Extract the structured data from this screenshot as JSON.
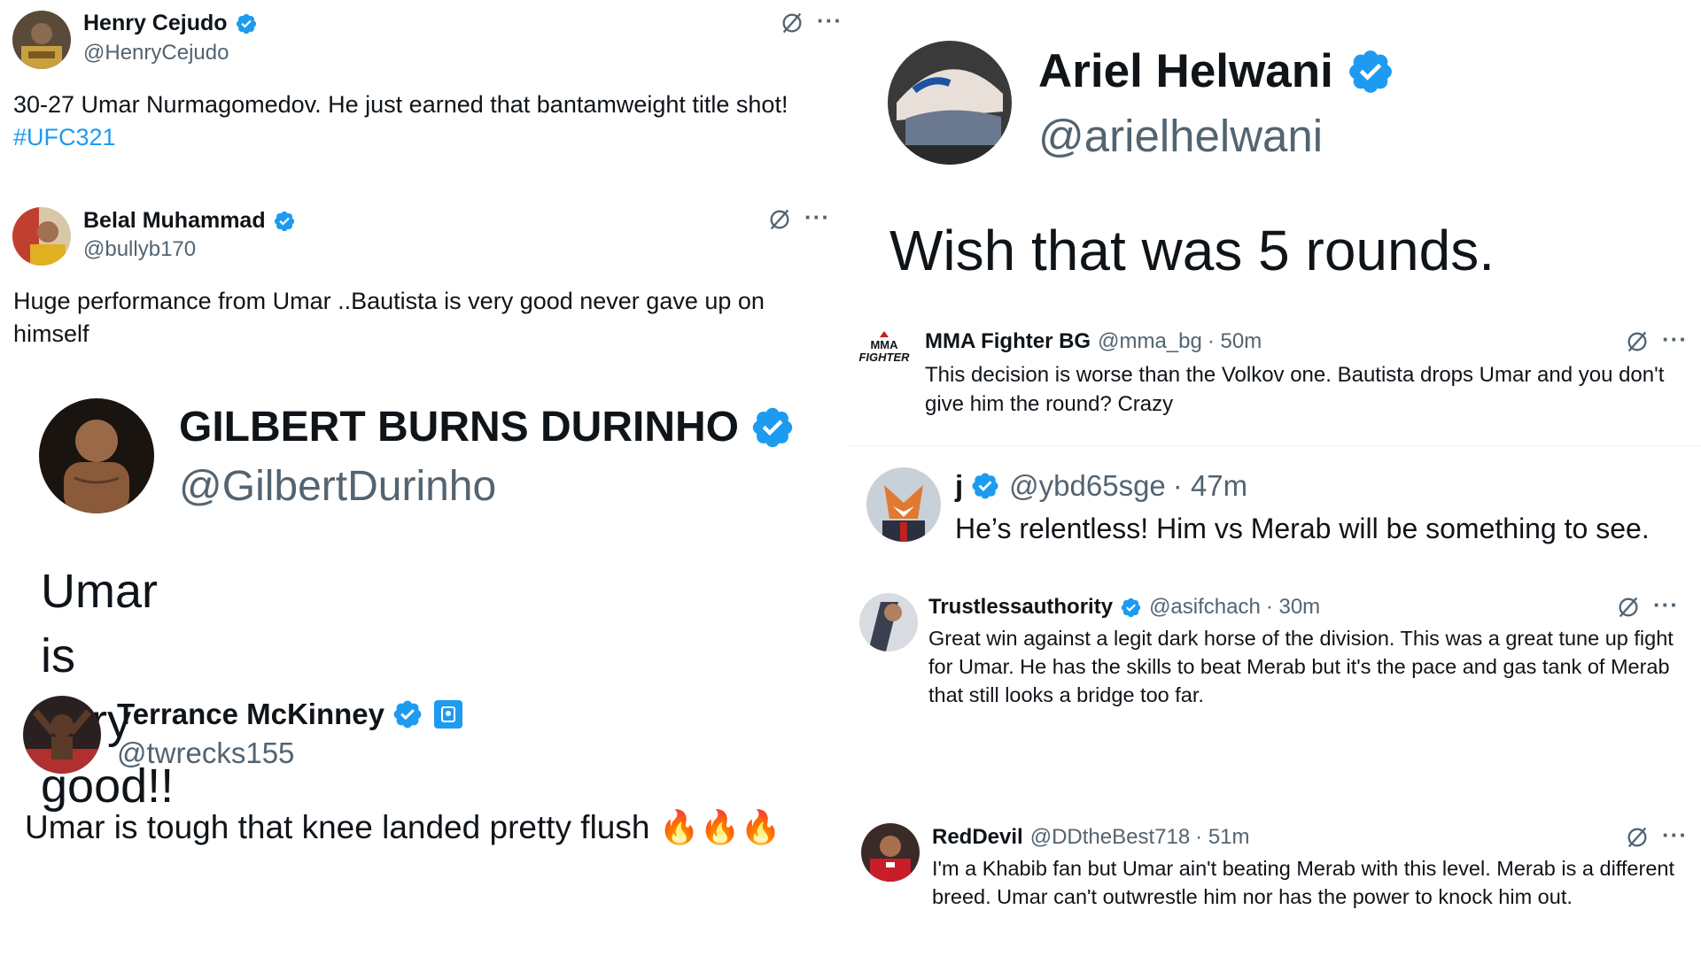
{
  "left": {
    "henry": {
      "name": "Henry Cejudo",
      "handle": "@HenryCejudo",
      "text": "30-27 Umar Nurmagomedov. He just earned that bantamweight title shot!",
      "hashtag": "#UFC321"
    },
    "belal": {
      "name": "Belal Muhammad",
      "handle": "@bullyb170",
      "text": "Huge performance from Umar ..Bautista is very good never gave up on himself"
    },
    "gilbert": {
      "name": "GILBERT BURNS DURINHO",
      "handle": "@GilbertDurinho",
      "text": "Umar is very good!!"
    },
    "terrance": {
      "name": "Terrance McKinney",
      "handle": "@twrecks155",
      "text": "Umar is  tough  that knee landed pretty flush",
      "emoji": "🔥🔥🔥"
    }
  },
  "right": {
    "ariel": {
      "name": "Ariel Helwani",
      "handle": "@arielhelwani",
      "text": "Wish that was 5 rounds."
    },
    "mmabg": {
      "logo_top": "MMA",
      "logo_bottom": "FIGHTER",
      "name": "MMA Fighter BG",
      "handle": "@mma_bg",
      "time": "· 50m",
      "text": "This decision is worse than the Volkov one. Bautista drops Umar and you don't give him the round? Crazy"
    },
    "j": {
      "name": "j",
      "handle": "@ybd65sge",
      "time": "· 47m",
      "text": "He’s relentless!  Him vs Merab will be something to see."
    },
    "trustless": {
      "name": "Trustlessauthority",
      "handle": "@asifchach",
      "time": "· 30m",
      "text": "Great win against a legit dark horse of the division. This was a great tune up fight for Umar. He has the skills to beat Merab but it's the pace and gas tank of Merab that still looks a bridge too far."
    },
    "reddevil": {
      "name": "RedDevil",
      "handle": "@DDtheBest718",
      "time": "· 51m",
      "text": "I'm a Khabib fan but Umar ain't beating Merab with this level. Merab is a different breed. Umar can't outwrestle him nor has the power to knock him out."
    }
  },
  "icons": {
    "more": "···",
    "verified_color": "#1d9bf0",
    "link_color": "#1d9bf0",
    "muted_color": "#536471"
  }
}
